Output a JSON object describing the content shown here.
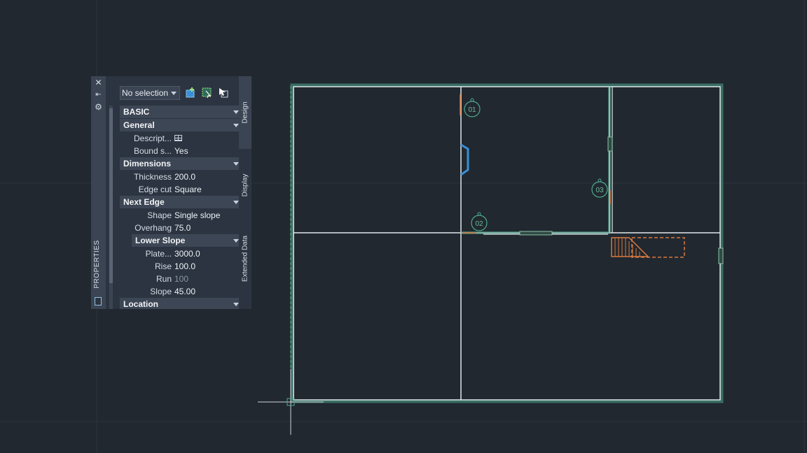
{
  "palette": {
    "title": "PROPERTIES",
    "selection": "No selection",
    "tabs": [
      "Design",
      "Display",
      "Extended Data"
    ],
    "sections": {
      "basic": "BASIC",
      "general": "General",
      "dimensions": "Dimensions",
      "next_edge": "Next Edge",
      "lower_slope": "Lower Slope",
      "location": "Location"
    },
    "props": {
      "description": {
        "label": "Descript..."
      },
      "bound": {
        "label": "Bound s...",
        "value": "Yes"
      },
      "thickness": {
        "label": "Thickness",
        "value": "200.0"
      },
      "edge_cut": {
        "label": "Edge cut",
        "value": "Square"
      },
      "shape": {
        "label": "Shape",
        "value": "Single slope"
      },
      "overhang": {
        "label": "Overhang",
        "value": "75.0"
      },
      "plate": {
        "label": "Plate...",
        "value": "3000.0"
      },
      "rise": {
        "label": "Rise",
        "value": "100.0"
      },
      "run": {
        "label": "Run",
        "value": "100"
      },
      "slope": {
        "label": "Slope",
        "value": "45.00"
      }
    }
  },
  "drawing": {
    "tags": [
      "01",
      "02",
      "03"
    ]
  },
  "colors": {
    "background": "#212830",
    "wall": "#dfe8ec",
    "wall_glow": "#4fa88e",
    "door": "#3a8fd6",
    "stair": "#d9793e"
  }
}
